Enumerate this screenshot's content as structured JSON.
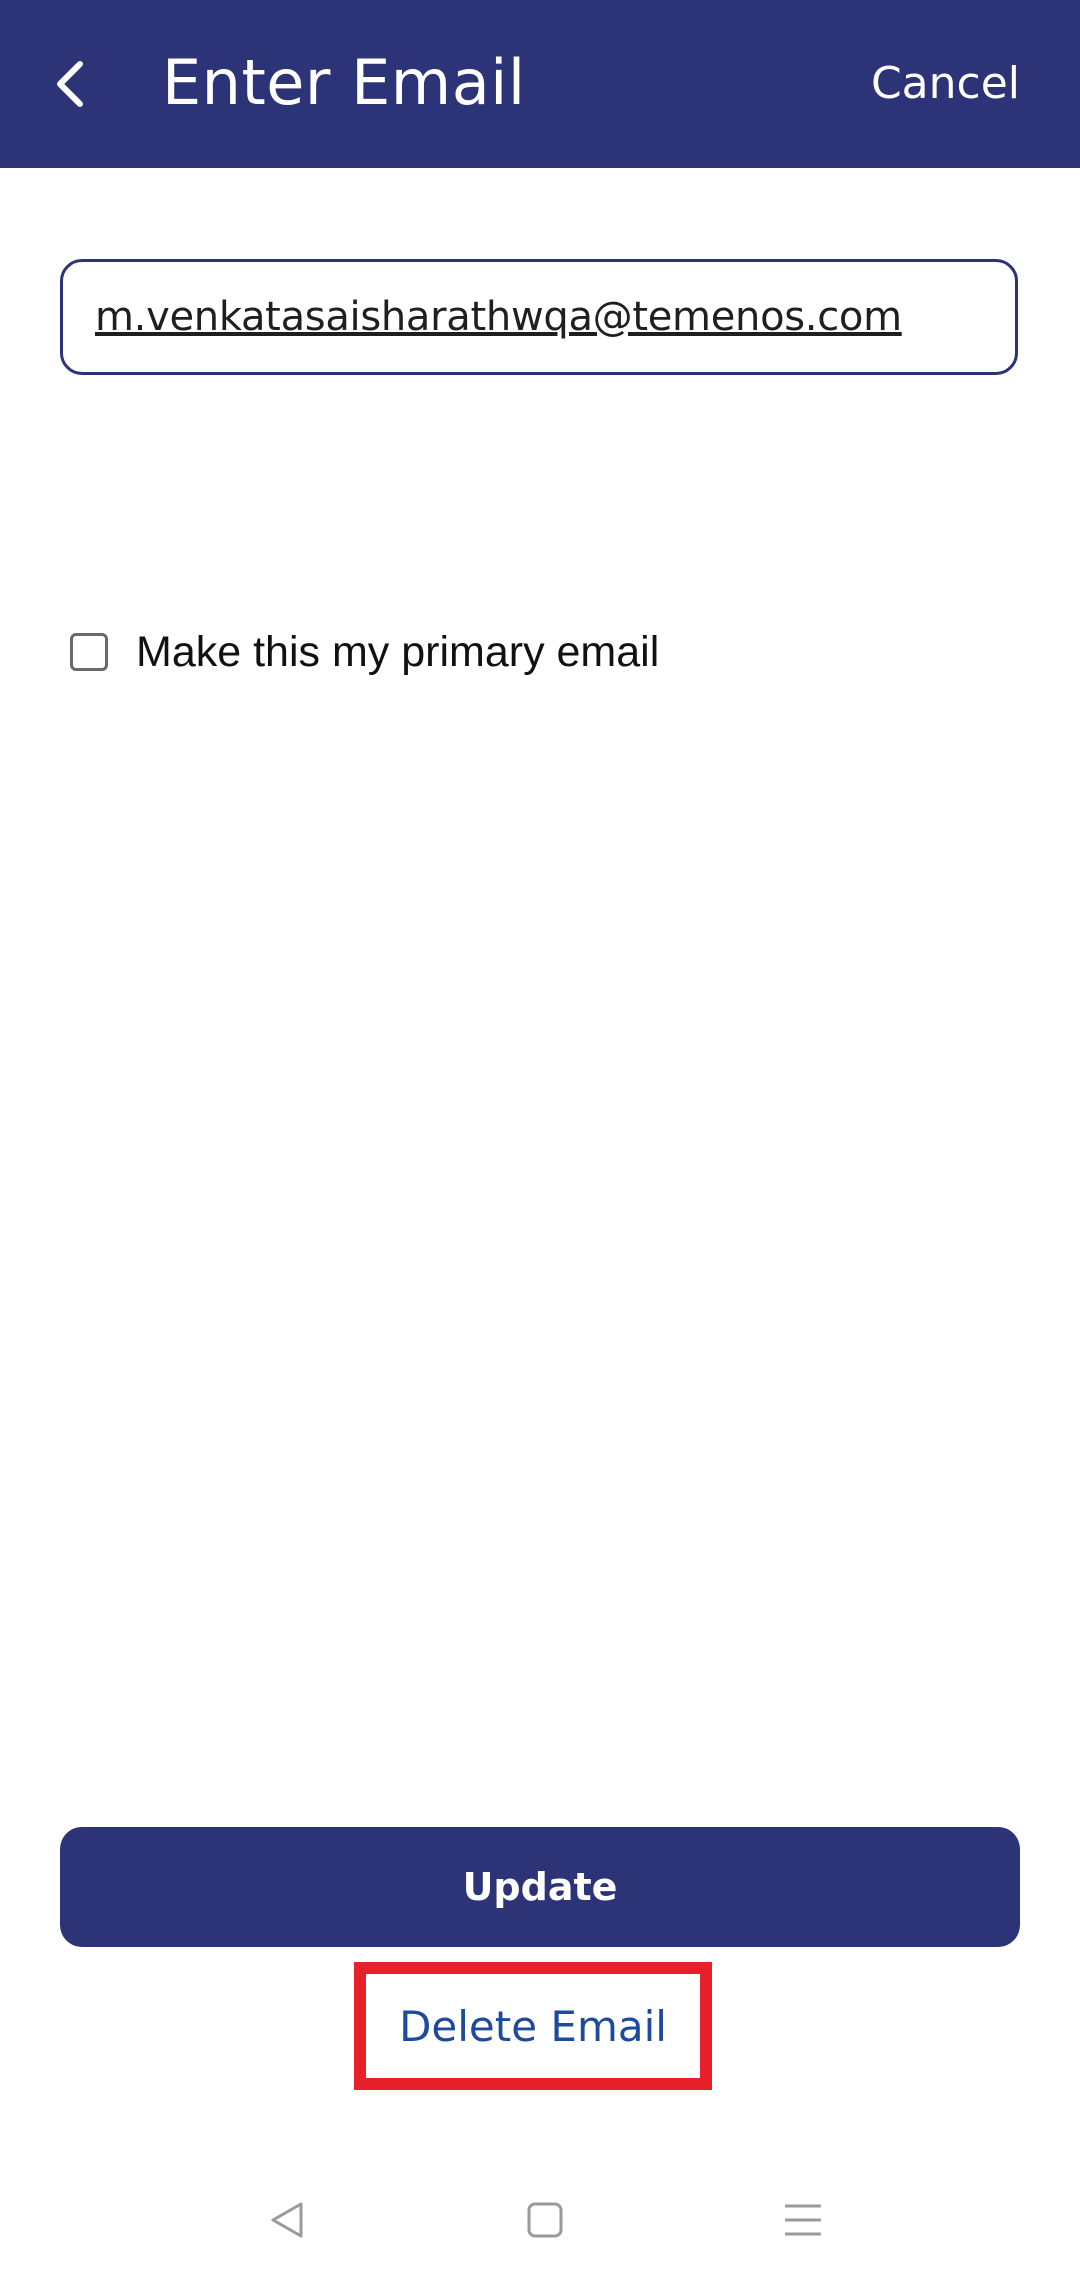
{
  "header": {
    "back_icon": "chevron-left-icon",
    "title": "Enter Email",
    "cancel_label": "Cancel",
    "background_color": "#2c3377"
  },
  "email_field": {
    "value": "m.venkatasaisharathwqa@temenos.com"
  },
  "primary_email": {
    "checked": false,
    "label": "Make this my primary email"
  },
  "actions": {
    "update_label": "Update",
    "delete_label": "Delete Email",
    "delete_highlight_color": "#e8202a"
  },
  "system_nav": {
    "back_icon": "triangle-back-icon",
    "home_icon": "square-home-icon",
    "menu_icon": "hamburger-menu-icon"
  }
}
